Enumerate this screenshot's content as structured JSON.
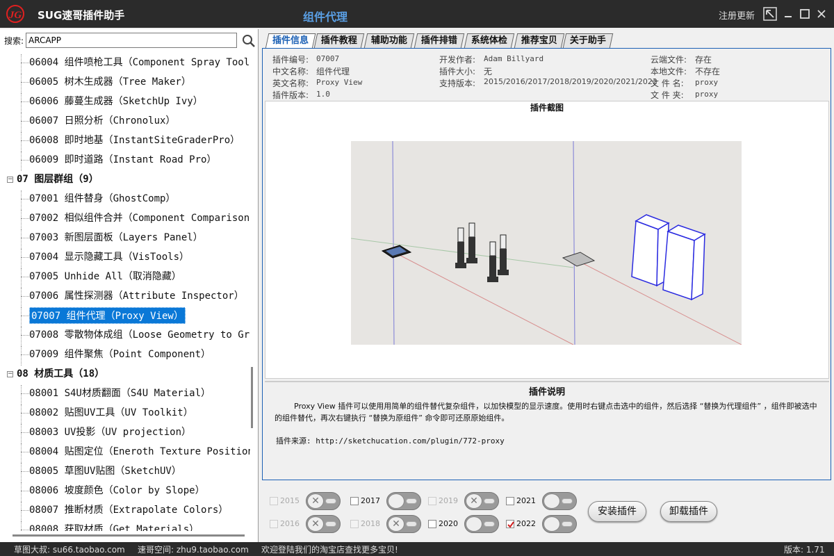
{
  "titlebar": {
    "logo_text": "JG",
    "app_title": "SUG速哥插件助手",
    "window_title": "组件代理",
    "register_label": "注册更新"
  },
  "search": {
    "label": "搜索:",
    "value": "ARCAPP"
  },
  "tree": {
    "items": [
      {
        "kind": "item",
        "text": "06004 组件喷枪工具（Component Spray Tool"
      },
      {
        "kind": "item",
        "text": "06005 树木生成器（Tree Maker）"
      },
      {
        "kind": "item",
        "text": "06006 藤蔓生成器（SketchUp Ivy）"
      },
      {
        "kind": "item",
        "text": "06007 日照分析（Chronolux）"
      },
      {
        "kind": "item",
        "text": "06008 即时地基（InstantSiteGraderPro）"
      },
      {
        "kind": "item",
        "text": "06009 即时道路（Instant Road Pro）"
      },
      {
        "kind": "group",
        "text": "07 图层群组（9）"
      },
      {
        "kind": "item",
        "text": "07001 组件替身（GhostComp）"
      },
      {
        "kind": "item",
        "text": "07002 相似组件合并（Component Comparison"
      },
      {
        "kind": "item",
        "text": "07003 新图层面板（Layers Panel）"
      },
      {
        "kind": "item",
        "text": "07004 显示隐藏工具（VisTools）"
      },
      {
        "kind": "item",
        "text": "07005 Unhide All（取消隐藏）"
      },
      {
        "kind": "item",
        "text": "07006 属性探测器（Attribute Inspector）"
      },
      {
        "kind": "item",
        "text": "07007 组件代理（Proxy View）",
        "selected": true
      },
      {
        "kind": "item",
        "text": "07008 零散物体成组（Loose Geometry to Gr"
      },
      {
        "kind": "item",
        "text": "07009 组件聚焦（Point Component）"
      },
      {
        "kind": "group",
        "text": "08 材质工具（18）"
      },
      {
        "kind": "item",
        "text": "08001 S4U材质翻面（S4U Material）"
      },
      {
        "kind": "item",
        "text": "08002 贴图UV工具（UV Toolkit）"
      },
      {
        "kind": "item",
        "text": "08003 UV投影（UV projection）"
      },
      {
        "kind": "item",
        "text": "08004 贴图定位（Eneroth Texture Position"
      },
      {
        "kind": "item",
        "text": "08005 草图UV贴图（SketchUV）"
      },
      {
        "kind": "item",
        "text": "08006 坡度颜色（Color by Slope）"
      },
      {
        "kind": "item",
        "text": "08007 推断材质（Extrapolate Colors）"
      },
      {
        "kind": "item",
        "text": "08008 获取材质（Get Materials）"
      }
    ]
  },
  "tabs": [
    "插件信息",
    "插件教程",
    "辅助功能",
    "插件排错",
    "系统体检",
    "推荐宝贝",
    "关于助手"
  ],
  "info": {
    "col1": [
      {
        "label": "插件编号:",
        "value": "07007"
      },
      {
        "label": "中文名称:",
        "value": "组件代理"
      },
      {
        "label": "英文名称:",
        "value": "Proxy View"
      },
      {
        "label": "插件版本:",
        "value": "1.0"
      }
    ],
    "col2": [
      {
        "label": "开发作者:",
        "value": "Adam Billyard"
      },
      {
        "label": "插件大小:",
        "value": "无"
      },
      {
        "label": "支持版本:",
        "value": "2015/2016/2017/2018/2019/2020/2021/2022"
      }
    ],
    "col3": [
      {
        "label": "云端文件:",
        "value": "存在"
      },
      {
        "label": "本地文件:",
        "value": "不存在"
      },
      {
        "label": "文 件 名:",
        "value": "proxy"
      },
      {
        "label": "文 件 夹:",
        "value": "proxy"
      }
    ]
  },
  "screenshot": {
    "title": "插件截图"
  },
  "description": {
    "title": "插件说明",
    "text": "Proxy View 插件可以使用用简单的组件替代复杂组件，以加快模型的显示速度。使用时右键点击选中的组件，然后选择 “替换为代理组件” ，组件即被选中的组件替代，再次右键执行 “替换为原组件” 命令即可还原原始组件。",
    "source": "插件来源: http://sketchucation.com/plugin/772-proxy"
  },
  "versions": [
    {
      "year": "2015",
      "enabled": false,
      "checked": false
    },
    {
      "year": "2016",
      "enabled": false,
      "checked": false
    },
    {
      "year": "2017",
      "enabled": true,
      "checked": false
    },
    {
      "year": "2018",
      "enabled": false,
      "checked": false
    },
    {
      "year": "2019",
      "enabled": false,
      "checked": false
    },
    {
      "year": "2020",
      "enabled": true,
      "checked": false
    },
    {
      "year": "2021",
      "enabled": true,
      "checked": false
    },
    {
      "year": "2022",
      "enabled": true,
      "checked": true
    }
  ],
  "buttons": {
    "install": "安装插件",
    "uninstall": "卸载插件"
  },
  "status": {
    "left1": "草图大叔: su66.taobao.com",
    "left2": "速哥空间: zhu9.taobao.com",
    "message": "欢迎登陆我们的淘宝店查找更多宝贝!",
    "version": "版本: 1.71"
  },
  "colors": {
    "accent": "#1a5fb4",
    "selection": "#0a78d7",
    "logo_red": "#e02020"
  }
}
